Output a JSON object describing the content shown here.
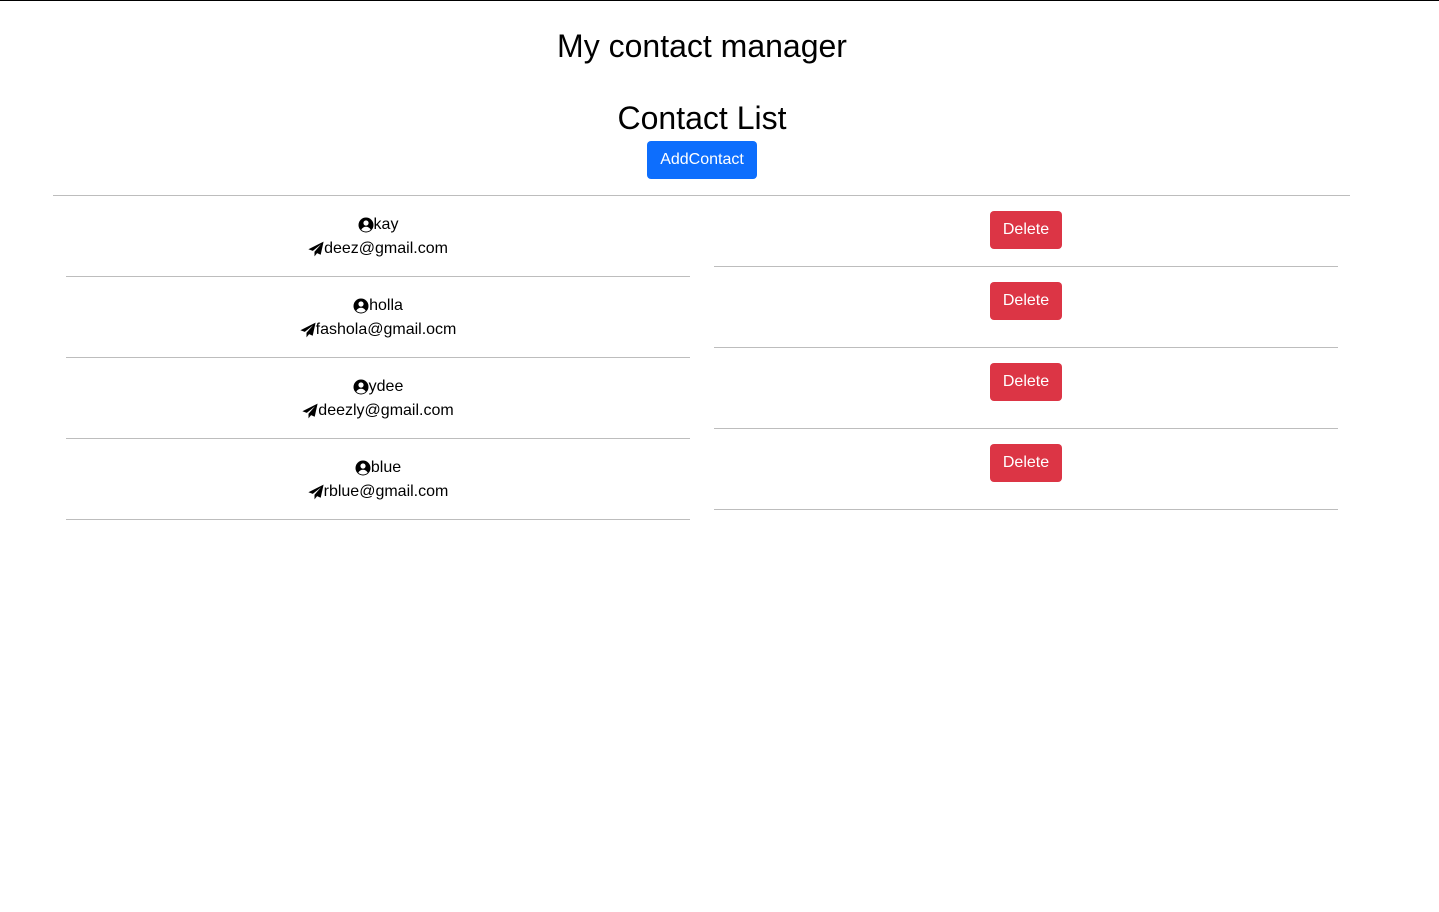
{
  "header": {
    "title": "My contact manager"
  },
  "contact_list": {
    "title": "Contact List",
    "add_button_label": "AddContact",
    "contacts": [
      {
        "name": "kay",
        "email": "deez@gmail.com"
      },
      {
        "name": "holla",
        "email": "fashola@gmail.ocm"
      },
      {
        "name": "ydee",
        "email": "deezly@gmail.com"
      },
      {
        "name": "blue",
        "email": "rblue@gmail.com"
      }
    ],
    "delete_button_label": "Delete"
  },
  "icons": {
    "name_icon": "user-circle-icon",
    "email_icon": "paper-plane-icon"
  },
  "colors": {
    "primary": "#0d6efd",
    "danger": "#dc3545",
    "divider": "#bdbdbd"
  }
}
